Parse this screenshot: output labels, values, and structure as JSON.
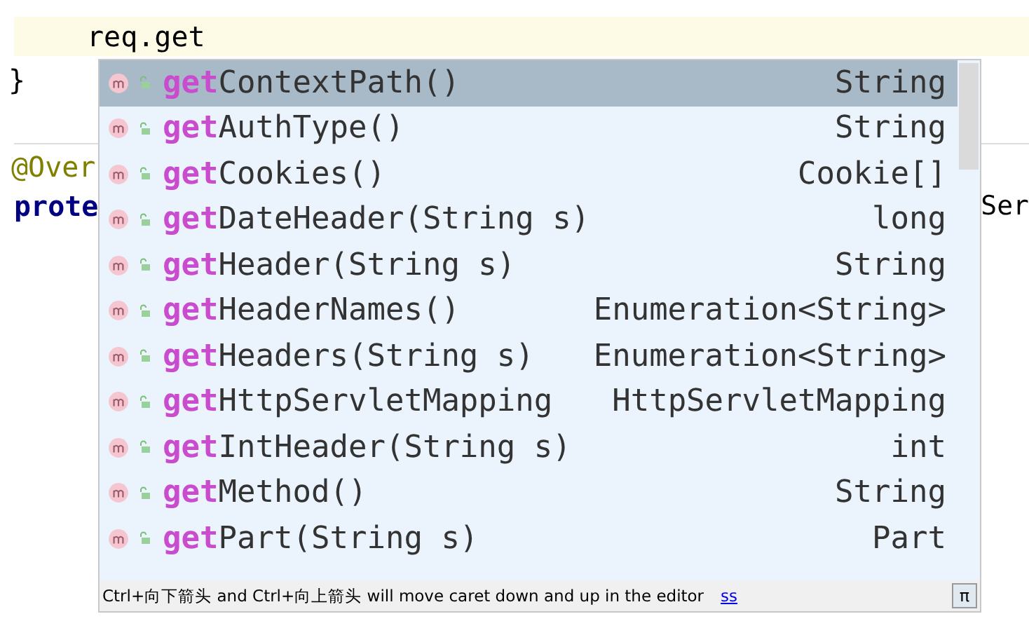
{
  "editor": {
    "lines": [
      {
        "kind": "current",
        "text": "req.get"
      },
      {
        "kind": "plain",
        "text": "}"
      },
      {
        "kind": "separator"
      },
      {
        "kind": "annotation",
        "text": "@Over"
      },
      {
        "kind": "keyword",
        "text": "prote",
        "tail": "Ser"
      }
    ]
  },
  "completion": {
    "items": [
      {
        "name": "**get**ContextPath()",
        "type": "String",
        "selected": true
      },
      {
        "name": "**get**AuthType()",
        "type": "String",
        "selected": false
      },
      {
        "name": "**get**Cookies()",
        "type": "Cookie[]",
        "selected": false
      },
      {
        "name": "**get**DateHeader(String s)",
        "type": "long",
        "selected": false
      },
      {
        "name": "**get**Header(String s)",
        "type": "String",
        "selected": false
      },
      {
        "name": "**get**HeaderNames()",
        "type": "Enumeration<String>",
        "selected": false
      },
      {
        "name": "**get**Headers(String s)",
        "type": "Enumeration<String>",
        "selected": false
      },
      {
        "name": "**get**HttpServletMapping",
        "type": "HttpServletMapping",
        "selected": false
      },
      {
        "name": "**get**IntHeader(String s)",
        "type": "int",
        "selected": false
      },
      {
        "name": "**get**Method()",
        "type": "String",
        "selected": false
      },
      {
        "name": "**get**Part(String s)",
        "type": "Part",
        "selected": false
      }
    ],
    "hint": "Ctrl+向下箭头 and Ctrl+向上箭头 will move caret down and up in the editor",
    "hint_link": "ss",
    "pin_button": "π"
  }
}
